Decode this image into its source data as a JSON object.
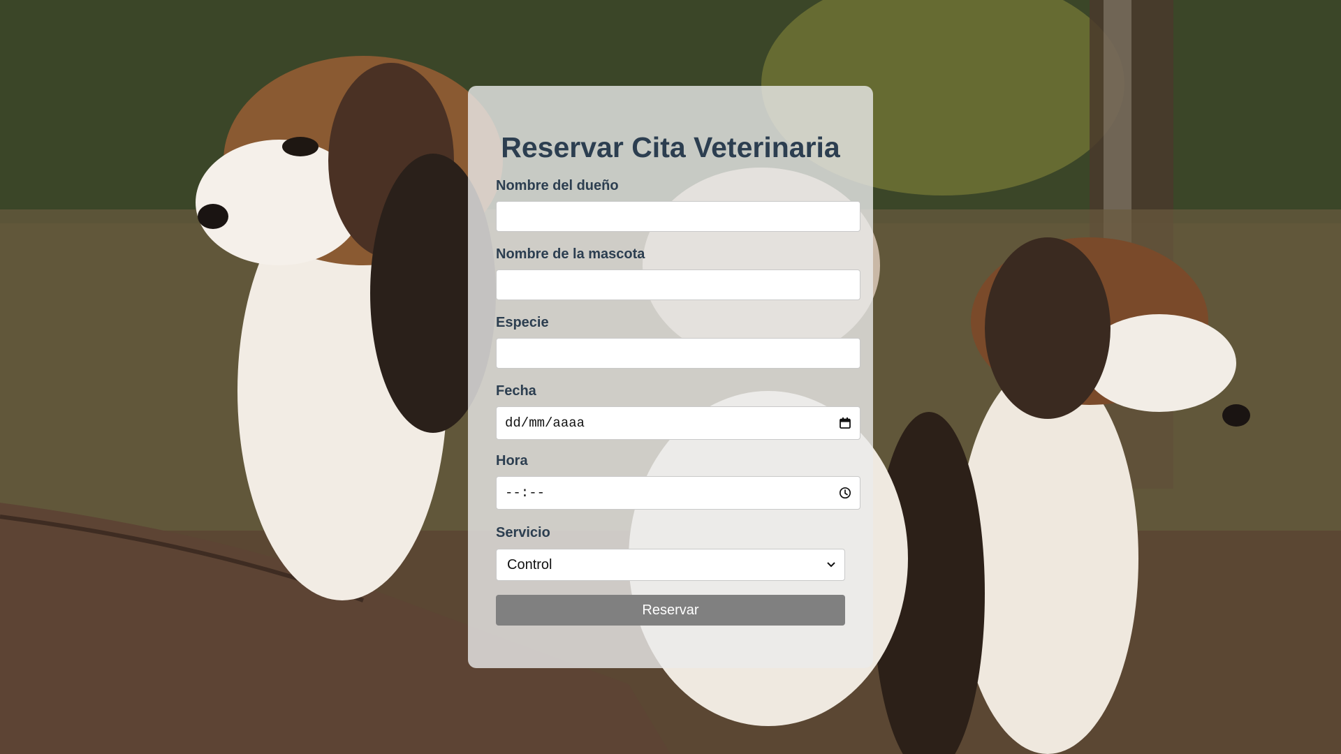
{
  "form": {
    "title": "Reservar Cita Veterinaria",
    "owner_label": "Nombre del dueño",
    "owner_value": "",
    "pet_label": "Nombre de la mascota",
    "pet_value": "",
    "species_label": "Especie",
    "species_value": "",
    "date_label": "Fecha",
    "date_placeholder": "dd/mm/aaaa",
    "time_label": "Hora",
    "time_placeholder": "--:--",
    "service_label": "Servicio",
    "service_selected": "Control",
    "submit_label": "Reservar"
  },
  "icons": {
    "date": "calendar-icon",
    "time": "clock-icon",
    "select": "chevron-down-icon"
  },
  "colors": {
    "title": "#2c3e50",
    "button": "#808080",
    "card": "#ebebeb"
  }
}
